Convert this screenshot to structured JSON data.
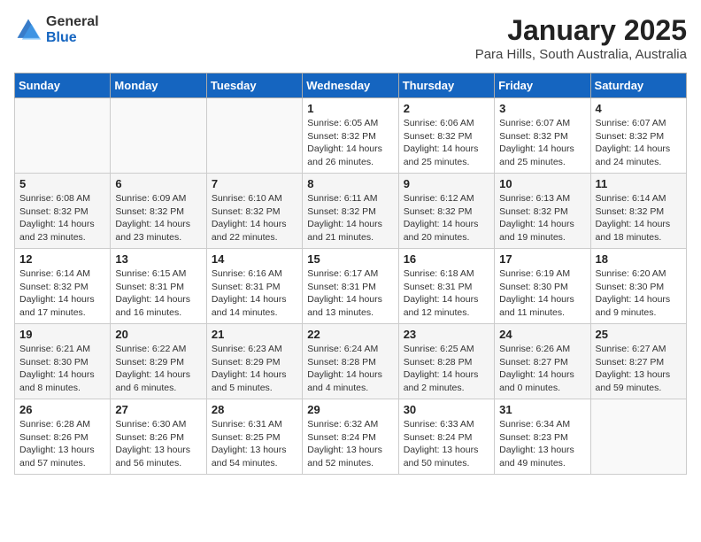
{
  "header": {
    "logo_general": "General",
    "logo_blue": "Blue",
    "month": "January 2025",
    "location": "Para Hills, South Australia, Australia"
  },
  "days_of_week": [
    "Sunday",
    "Monday",
    "Tuesday",
    "Wednesday",
    "Thursday",
    "Friday",
    "Saturday"
  ],
  "weeks": [
    [
      {
        "num": "",
        "info": ""
      },
      {
        "num": "",
        "info": ""
      },
      {
        "num": "",
        "info": ""
      },
      {
        "num": "1",
        "info": "Sunrise: 6:05 AM\nSunset: 8:32 PM\nDaylight: 14 hours\nand 26 minutes."
      },
      {
        "num": "2",
        "info": "Sunrise: 6:06 AM\nSunset: 8:32 PM\nDaylight: 14 hours\nand 25 minutes."
      },
      {
        "num": "3",
        "info": "Sunrise: 6:07 AM\nSunset: 8:32 PM\nDaylight: 14 hours\nand 25 minutes."
      },
      {
        "num": "4",
        "info": "Sunrise: 6:07 AM\nSunset: 8:32 PM\nDaylight: 14 hours\nand 24 minutes."
      }
    ],
    [
      {
        "num": "5",
        "info": "Sunrise: 6:08 AM\nSunset: 8:32 PM\nDaylight: 14 hours\nand 23 minutes."
      },
      {
        "num": "6",
        "info": "Sunrise: 6:09 AM\nSunset: 8:32 PM\nDaylight: 14 hours\nand 23 minutes."
      },
      {
        "num": "7",
        "info": "Sunrise: 6:10 AM\nSunset: 8:32 PM\nDaylight: 14 hours\nand 22 minutes."
      },
      {
        "num": "8",
        "info": "Sunrise: 6:11 AM\nSunset: 8:32 PM\nDaylight: 14 hours\nand 21 minutes."
      },
      {
        "num": "9",
        "info": "Sunrise: 6:12 AM\nSunset: 8:32 PM\nDaylight: 14 hours\nand 20 minutes."
      },
      {
        "num": "10",
        "info": "Sunrise: 6:13 AM\nSunset: 8:32 PM\nDaylight: 14 hours\nand 19 minutes."
      },
      {
        "num": "11",
        "info": "Sunrise: 6:14 AM\nSunset: 8:32 PM\nDaylight: 14 hours\nand 18 minutes."
      }
    ],
    [
      {
        "num": "12",
        "info": "Sunrise: 6:14 AM\nSunset: 8:32 PM\nDaylight: 14 hours\nand 17 minutes."
      },
      {
        "num": "13",
        "info": "Sunrise: 6:15 AM\nSunset: 8:31 PM\nDaylight: 14 hours\nand 16 minutes."
      },
      {
        "num": "14",
        "info": "Sunrise: 6:16 AM\nSunset: 8:31 PM\nDaylight: 14 hours\nand 14 minutes."
      },
      {
        "num": "15",
        "info": "Sunrise: 6:17 AM\nSunset: 8:31 PM\nDaylight: 14 hours\nand 13 minutes."
      },
      {
        "num": "16",
        "info": "Sunrise: 6:18 AM\nSunset: 8:31 PM\nDaylight: 14 hours\nand 12 minutes."
      },
      {
        "num": "17",
        "info": "Sunrise: 6:19 AM\nSunset: 8:30 PM\nDaylight: 14 hours\nand 11 minutes."
      },
      {
        "num": "18",
        "info": "Sunrise: 6:20 AM\nSunset: 8:30 PM\nDaylight: 14 hours\nand 9 minutes."
      }
    ],
    [
      {
        "num": "19",
        "info": "Sunrise: 6:21 AM\nSunset: 8:30 PM\nDaylight: 14 hours\nand 8 minutes."
      },
      {
        "num": "20",
        "info": "Sunrise: 6:22 AM\nSunset: 8:29 PM\nDaylight: 14 hours\nand 6 minutes."
      },
      {
        "num": "21",
        "info": "Sunrise: 6:23 AM\nSunset: 8:29 PM\nDaylight: 14 hours\nand 5 minutes."
      },
      {
        "num": "22",
        "info": "Sunrise: 6:24 AM\nSunset: 8:28 PM\nDaylight: 14 hours\nand 4 minutes."
      },
      {
        "num": "23",
        "info": "Sunrise: 6:25 AM\nSunset: 8:28 PM\nDaylight: 14 hours\nand 2 minutes."
      },
      {
        "num": "24",
        "info": "Sunrise: 6:26 AM\nSunset: 8:27 PM\nDaylight: 14 hours\nand 0 minutes."
      },
      {
        "num": "25",
        "info": "Sunrise: 6:27 AM\nSunset: 8:27 PM\nDaylight: 13 hours\nand 59 minutes."
      }
    ],
    [
      {
        "num": "26",
        "info": "Sunrise: 6:28 AM\nSunset: 8:26 PM\nDaylight: 13 hours\nand 57 minutes."
      },
      {
        "num": "27",
        "info": "Sunrise: 6:30 AM\nSunset: 8:26 PM\nDaylight: 13 hours\nand 56 minutes."
      },
      {
        "num": "28",
        "info": "Sunrise: 6:31 AM\nSunset: 8:25 PM\nDaylight: 13 hours\nand 54 minutes."
      },
      {
        "num": "29",
        "info": "Sunrise: 6:32 AM\nSunset: 8:24 PM\nDaylight: 13 hours\nand 52 minutes."
      },
      {
        "num": "30",
        "info": "Sunrise: 6:33 AM\nSunset: 8:24 PM\nDaylight: 13 hours\nand 50 minutes."
      },
      {
        "num": "31",
        "info": "Sunrise: 6:34 AM\nSunset: 8:23 PM\nDaylight: 13 hours\nand 49 minutes."
      },
      {
        "num": "",
        "info": ""
      }
    ]
  ]
}
